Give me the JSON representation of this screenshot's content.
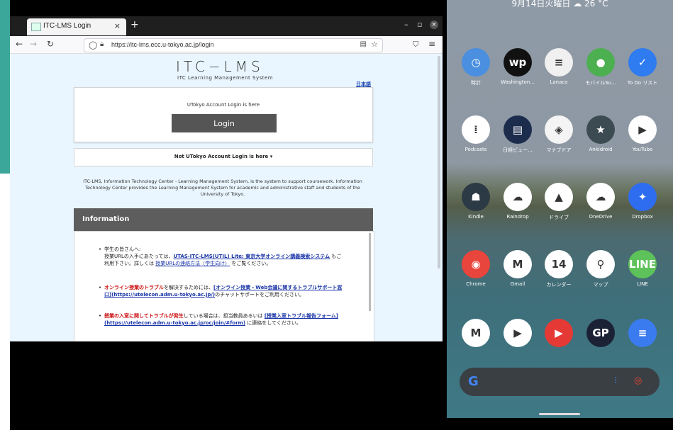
{
  "browser": {
    "tab_title": "ITC-LMS Login",
    "tab_close": "×",
    "new_tab": "+",
    "minimize": "–",
    "maximize": "▫",
    "close": "×",
    "back": "←",
    "forward": "→",
    "reload": "↻",
    "url": "https://itc-lms.ecc.u-tokyo.ac.jp/login",
    "menu": "≡"
  },
  "page": {
    "logo": "ITC−LMS",
    "logo_sub": "ITC Learning Management System",
    "language_link": "日本語",
    "login_caption": "UTokyo Account Login is here",
    "login_button": "Login",
    "not_utokyo": "Not UTokyo Account Login is here ▾",
    "description": "ITC-LMS, Information Technology Center - Learning Management System, is the system to support coursework. Information Technology Center provides the Learning Management System for academic and administrative staff and students of the University of Tokyo.",
    "info_title": "Information",
    "notices": [
      {
        "line1": "学生の皆さんへ:",
        "line2": "授業URLの入手にあたっては、",
        "link": "UTAS-ITC-LMS(UTIL) Lite: 東京大学オンライン講義検索システム",
        "text": " もご利用下さい。詳しくは ",
        "note": "授業URLの連絡方法（学生向け）",
        "end": " をご覧ください。"
      },
      {
        "red": "オンライン授業のトラブル",
        "text": "を解決するためには、",
        "link": "[オンライン授業・Web会議に関するトラブルサポート窓口](https://utelecon.adm.u-tokyo.ac.jp/)",
        "end": "のチャットサポートをご利用ください。"
      },
      {
        "red": "授業の入室に関してトラブルが発生",
        "text": "している場合は、担当教員あるいは ",
        "link": "[授業入室トラブル報告フォーム](https://utelecon.adm.u-tokyo.ac.jp/oc/join/#form)",
        "end": " に連絡をしてください。"
      }
    ]
  },
  "phone": {
    "status": "9月14日火曜日 ☁ 26 °C",
    "apps": [
      {
        "label": "時計",
        "glyph": "◷",
        "color": "#4a8fe0",
        "icon": "clock-icon"
      },
      {
        "label": "Washington...",
        "glyph": "wp",
        "color": "#111111",
        "icon": "washington-post-icon"
      },
      {
        "label": "Lanaco",
        "glyph": "≡",
        "color": "#f0f0f0",
        "icon": "lanaco-icon"
      },
      {
        "label": "モバイルSu...",
        "glyph": "●",
        "color": "#4caf50",
        "icon": "mobile-suica-icon"
      },
      {
        "label": "To Do リスト",
        "glyph": "✓",
        "color": "#2f7bf0",
        "icon": "todo-icon"
      },
      {
        "label": "Podcasts",
        "glyph": "⁞",
        "color": "#ffffff",
        "icon": "podcasts-icon"
      },
      {
        "label": "日経ビュー...",
        "glyph": "▤",
        "color": "#1c2c4c",
        "icon": "nikkei-icon"
      },
      {
        "label": "マナブドア",
        "glyph": "◈",
        "color": "#f4f4f4",
        "icon": "manabu-icon"
      },
      {
        "label": "Ankidroid",
        "glyph": "★",
        "color": "#3c4a52",
        "icon": "ankidroid-icon"
      },
      {
        "label": "YouTube",
        "glyph": "▶",
        "color": "#ffffff",
        "icon": "youtube-icon"
      },
      {
        "label": "Kindle",
        "glyph": "☗",
        "color": "#2b3a44",
        "icon": "kindle-icon"
      },
      {
        "label": "Raindrop",
        "glyph": "☁",
        "color": "#ffffff",
        "icon": "raindrop-icon"
      },
      {
        "label": "ドライブ",
        "glyph": "▲",
        "color": "#ffffff",
        "icon": "drive-icon"
      },
      {
        "label": "OneDrive",
        "glyph": "☁",
        "color": "#ffffff",
        "icon": "onedrive-icon"
      },
      {
        "label": "Dropbox",
        "glyph": "✦",
        "color": "#2e6df0",
        "icon": "dropbox-icon"
      },
      {
        "label": "Chrome",
        "glyph": "◉",
        "color": "#e8453c",
        "icon": "chrome-icon"
      },
      {
        "label": "Gmail",
        "glyph": "M",
        "color": "#ffffff",
        "icon": "gmail-icon"
      },
      {
        "label": "カレンダー",
        "glyph": "14",
        "color": "#ffffff",
        "icon": "calendar-icon"
      },
      {
        "label": "マップ",
        "glyph": "⚲",
        "color": "#ffffff",
        "icon": "maps-icon"
      },
      {
        "label": "LINE",
        "glyph": "LINE",
        "color": "#5ec25a",
        "icon": "line-icon"
      },
      {
        "label": "",
        "glyph": "M",
        "color": "#ffffff",
        "icon": "gmail-dock-icon"
      },
      {
        "label": "",
        "glyph": "▶",
        "color": "#ffffff",
        "icon": "youtube-dock-icon"
      },
      {
        "label": "",
        "glyph": "▶",
        "color": "#e53935",
        "icon": "youtube-music-icon"
      },
      {
        "label": "",
        "glyph": "GP",
        "color": "#1c2236",
        "icon": "gp-icon"
      },
      {
        "label": "",
        "glyph": "≡",
        "color": "#3b7bf0",
        "icon": "messages-icon"
      }
    ],
    "search_g": "G",
    "search_mic": "⁝",
    "search_lens": "◎"
  }
}
